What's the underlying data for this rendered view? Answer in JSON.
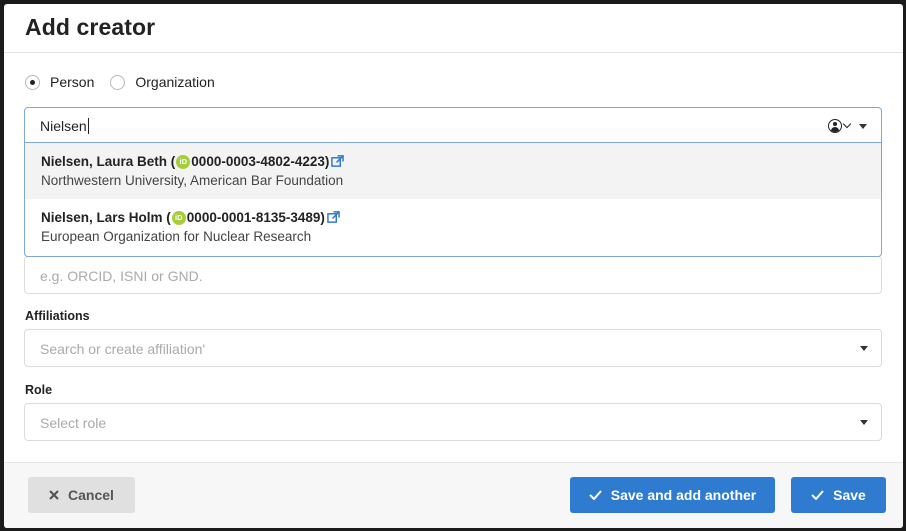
{
  "modal": {
    "title": "Add creator"
  },
  "type_selector": {
    "options": [
      {
        "label": "Person",
        "checked": true
      },
      {
        "label": "Organization",
        "checked": false
      }
    ]
  },
  "search": {
    "value": "Nielsen"
  },
  "results": [
    {
      "name": "Nielsen, Laura Beth (",
      "orcid": "0000-0003-4802-4223",
      "suffix": ")",
      "affiliation": "Northwestern University, American Bar Foundation"
    },
    {
      "name": "Nielsen, Lars Holm (",
      "orcid": "0000-0001-8135-3489",
      "suffix": ")",
      "affiliation": "European Organization for Nuclear Research"
    }
  ],
  "identifiers": {
    "placeholder": "e.g. ORCID, ISNI or GND."
  },
  "affiliations": {
    "label": "Affiliations",
    "placeholder": "Search or create affiliation'"
  },
  "role": {
    "label": "Role",
    "placeholder": "Select role"
  },
  "footer": {
    "cancel_label": "Cancel",
    "save_another_label": "Save and add another",
    "save_label": "Save"
  },
  "colors": {
    "primary": "#2f7bcf",
    "orcid": "#a6ce39",
    "focus_border": "#7fa6d5"
  },
  "icons": {
    "orcid_badge_text": "iD"
  }
}
